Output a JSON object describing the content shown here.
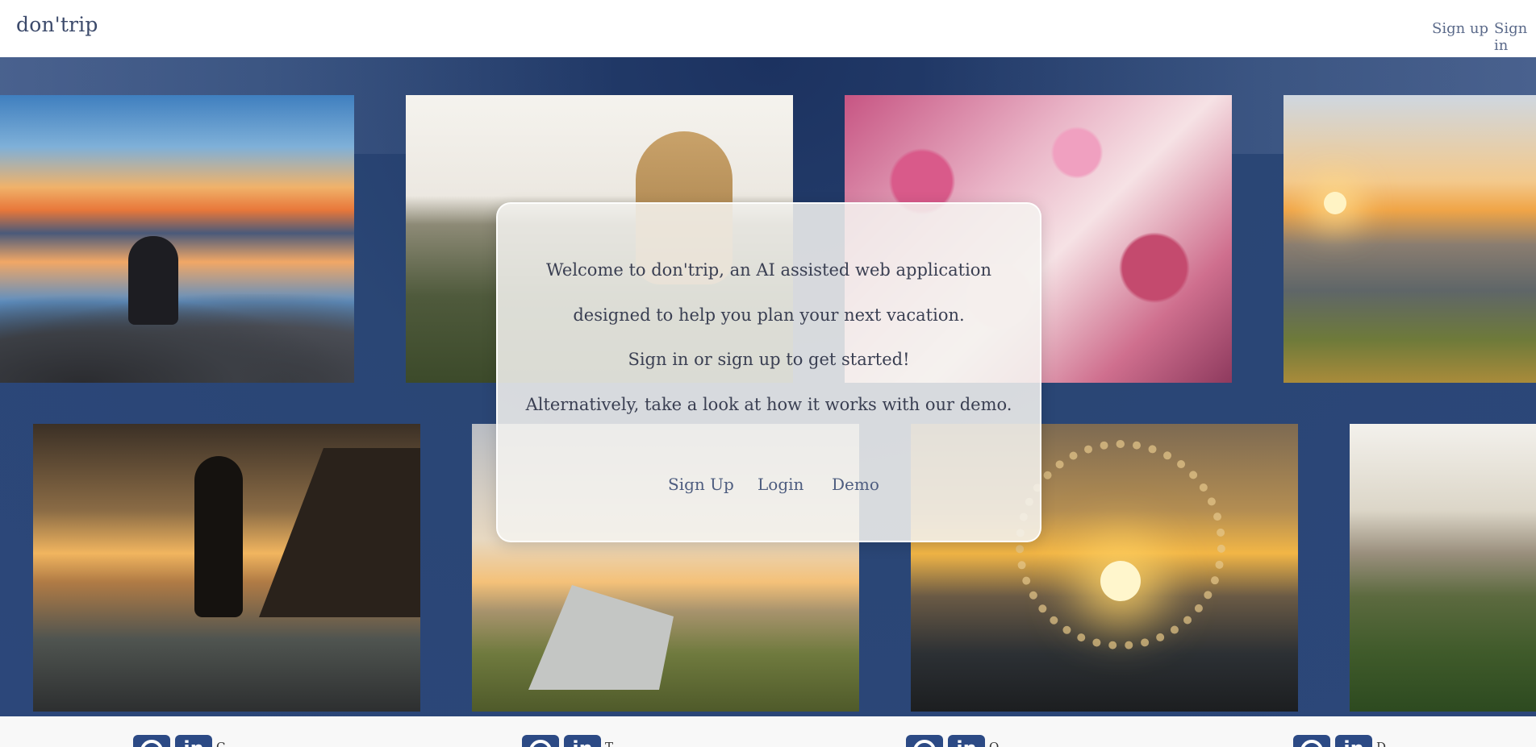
{
  "navbar": {
    "brand": "don'trip",
    "links": {
      "signup": "Sign up",
      "signin": "Sign in"
    }
  },
  "hero": {
    "photos_row1": [
      "lake-sunset-person",
      "girl-mountain-view",
      "festival-crowd",
      "mountain-sunrise-photographer"
    ],
    "photos_row2": [
      "surfer-silhouette-sunset",
      "tent-mountain-sunset",
      "hair-splash-sunset",
      "forest-mountain-sun"
    ]
  },
  "modal": {
    "line1": "Welcome to don'trip, an AI assisted web application",
    "line2": "designed to help you plan your next vacation.",
    "line3": "Sign in or sign up to get started!",
    "line4": "Alternatively, take a look at how it works with our demo.",
    "buttons": {
      "signup": "Sign Up",
      "login": "Login",
      "demo": "Demo"
    }
  },
  "footer": {
    "members": [
      {
        "initial": "C"
      },
      {
        "initial": "T"
      },
      {
        "initial": "O"
      },
      {
        "initial": "D"
      }
    ]
  },
  "colors": {
    "hero_bg": "#2c477a",
    "accent_link": "#5b6a8a",
    "social_button": "#2c4a85"
  }
}
